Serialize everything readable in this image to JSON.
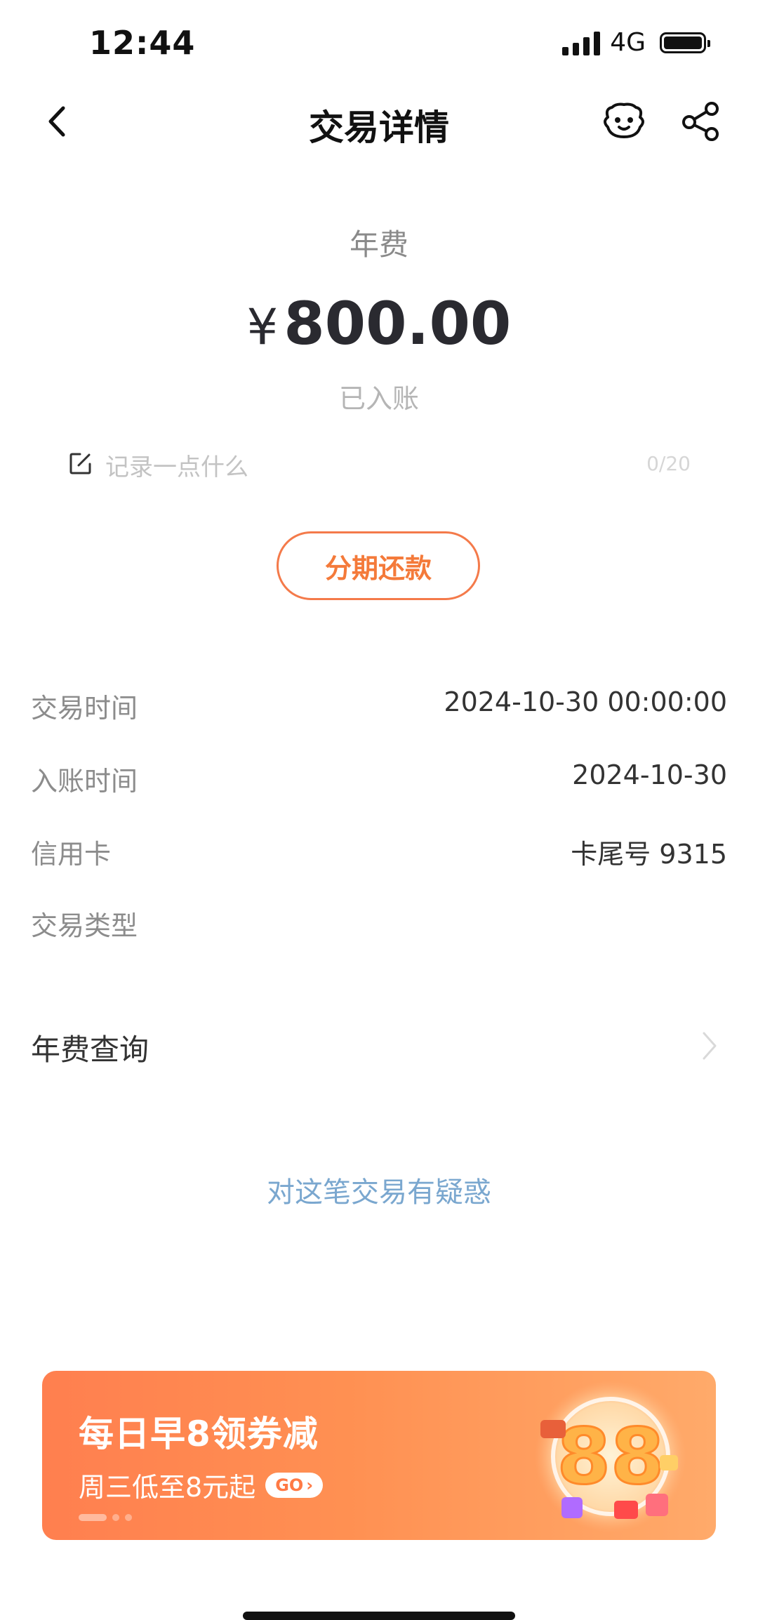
{
  "status_bar": {
    "time": "12:44",
    "network": "4G"
  },
  "nav": {
    "title": "交易详情",
    "icons": [
      "back-chevron-icon",
      "robot-assistant-icon",
      "share-icon"
    ]
  },
  "summary": {
    "category": "年费",
    "currency_symbol": "¥",
    "amount": "800.00",
    "status": "已入账"
  },
  "memo": {
    "placeholder": "记录一点什么",
    "count": "0/20"
  },
  "installment_button": {
    "label": "分期还款",
    "color": "#f47a3a"
  },
  "details": [
    {
      "label": "交易时间",
      "value": "2024-10-30 00:00:00"
    },
    {
      "label": "入账时间",
      "value": "2024-10-30"
    },
    {
      "label": "信用卡",
      "value": "卡尾号 9315"
    },
    {
      "label": "交易类型",
      "value": ""
    }
  ],
  "fee_query": {
    "label": "年费查询"
  },
  "dispute": {
    "label": "对这笔交易有疑惑",
    "color": "#7aa7cf"
  },
  "banner": {
    "title": "每日早8领券减",
    "subtitle": "周三低至8元起",
    "go_label": "GO",
    "art_text": "88",
    "colors": [
      "#ff7f4f",
      "#ffaa6a"
    ]
  }
}
